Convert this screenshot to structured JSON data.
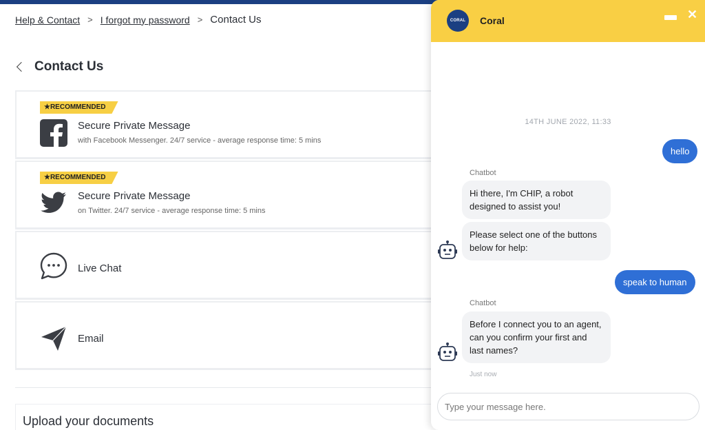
{
  "breadcrumb": {
    "items": [
      "Help & Contact",
      "I forgot my password"
    ],
    "current": "Contact Us"
  },
  "page": {
    "title": "Contact Us"
  },
  "contact_options": [
    {
      "badge": "★RECOMMENDED",
      "title": "Secure Private Message",
      "subtitle": "with Facebook Messenger. 24/7 service - average response time: 5 mins",
      "icon": "facebook-icon"
    },
    {
      "badge": "★RECOMMENDED",
      "title": "Secure Private Message",
      "subtitle": "on Twitter. 24/7 service - average response time: 5 mins",
      "icon": "twitter-icon"
    },
    {
      "title": "Live Chat",
      "icon": "chat-bubble-icon"
    },
    {
      "title": "Email",
      "icon": "paper-plane-icon"
    }
  ],
  "upload": {
    "title": "Upload your documents"
  },
  "chat": {
    "brand": "Coral",
    "logo_text": "CORAL",
    "date": "14TH JUNE 2022, 11:33",
    "messages": {
      "user1": "hello",
      "bot1_sender": "Chatbot",
      "bot1_a": "Hi there, I'm CHIP, a robot designed to assist you!",
      "bot1_b": "Please select one of the buttons below for help:",
      "user2": "speak to human",
      "bot2_sender": "Chatbot",
      "bot2": "Before I connect you to an agent, can you confirm your first and last names?",
      "timestamp": "Just now"
    },
    "input_placeholder": "Type your message here."
  },
  "colors": {
    "accent_yellow": "#f9cf44",
    "brand_blue": "#1b3f82",
    "user_bubble": "#2f6fd6",
    "bot_bubble": "#f2f3f5"
  }
}
